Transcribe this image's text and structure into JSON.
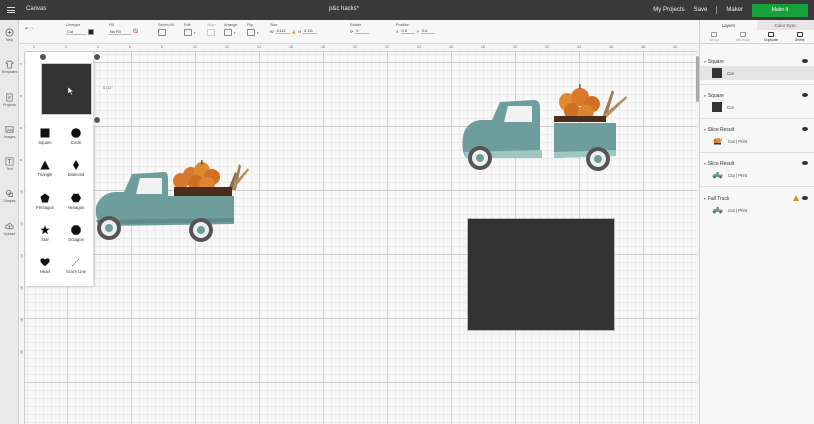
{
  "titlebar": {
    "app_title": "Canvas",
    "project_title": "p&c hacks*",
    "my_projects": "My Projects",
    "save": "Save",
    "machine": "Maker",
    "make_button": "Make It"
  },
  "left_tools": [
    {
      "label": "New",
      "icon": "plus-circle-icon"
    },
    {
      "label": "Templates",
      "icon": "shirt-icon"
    },
    {
      "label": "Projects",
      "icon": "projects-icon"
    },
    {
      "label": "Images",
      "icon": "image-icon"
    },
    {
      "label": "Text",
      "icon": "text-icon"
    },
    {
      "label": "Shapes",
      "icon": "shapes-icon"
    },
    {
      "label": "Upload",
      "icon": "upload-cloud-icon"
    }
  ],
  "edit_toolbar": {
    "linetype_label": "Linetype",
    "linetype_value": "Cut",
    "fill_label": "Fill",
    "fill_value": "No Fill",
    "select_all_label": "Select All",
    "edit_label": "Edit",
    "align_label": "Align",
    "arrange_label": "Arrange",
    "flip_label": "Flip",
    "size_label": "Size",
    "w_label": "W",
    "w_value": "5.111",
    "h_label": "H",
    "h_value": "5.111",
    "rotate_label": "Rotate",
    "rotate_value": "0",
    "position_label": "Position",
    "x_label": "X",
    "x_value": "0.5",
    "y_label": "Y",
    "y_value": "0.6"
  },
  "ruler_top": [
    "0",
    "2",
    "4",
    "6",
    "8",
    "10",
    "12",
    "14",
    "16",
    "18",
    "20",
    "22",
    "24",
    "26",
    "28",
    "30",
    "32",
    "34",
    "36",
    "38",
    "40",
    "42",
    "44"
  ],
  "ruler_left": [
    "2",
    "4",
    "6",
    "8",
    "10",
    "12",
    "14",
    "16",
    "18",
    "20"
  ],
  "shapes": [
    {
      "label": "Square",
      "icon": "square-icon"
    },
    {
      "label": "Circle",
      "icon": "circle-icon"
    },
    {
      "label": "Triangle",
      "icon": "triangle-icon"
    },
    {
      "label": "Diamond",
      "icon": "diamond-icon"
    },
    {
      "label": "Pentagon",
      "icon": "pentagon-icon"
    },
    {
      "label": "Hexagon",
      "icon": "hexagon-icon"
    },
    {
      "label": "Star",
      "icon": "star-icon"
    },
    {
      "label": "Octagon",
      "icon": "octagon-icon"
    },
    {
      "label": "Heart",
      "icon": "heart-icon"
    },
    {
      "label": "Score Line",
      "icon": "score-line-icon"
    }
  ],
  "selection": {
    "dimension_label": "5.111\""
  },
  "layers_panel": {
    "tab_layers": "Layers",
    "tab_color_sync": "Color Sync",
    "toolbar": [
      "Group",
      "UnGroup",
      "Duplicate",
      "Delete"
    ],
    "layers": [
      {
        "name": "Square",
        "detail": "Cut",
        "thumb": "square"
      },
      {
        "name": "Square",
        "detail": "Cut",
        "thumb": "square"
      },
      {
        "name": "Slice Result",
        "detail": "Cut | Print",
        "thumb": "pumpkin"
      },
      {
        "name": "Slice Result",
        "detail": "Cut | Print",
        "thumb": "truck"
      },
      {
        "name": "Fall Truck",
        "detail": "Cut | Print",
        "thumb": "truck"
      }
    ]
  },
  "colors": {
    "truck": "#6e9e9c",
    "pumpkin": "#d97a2a",
    "square": "#333333",
    "make_button": "#18a03a",
    "warning": "#e08a1e"
  }
}
